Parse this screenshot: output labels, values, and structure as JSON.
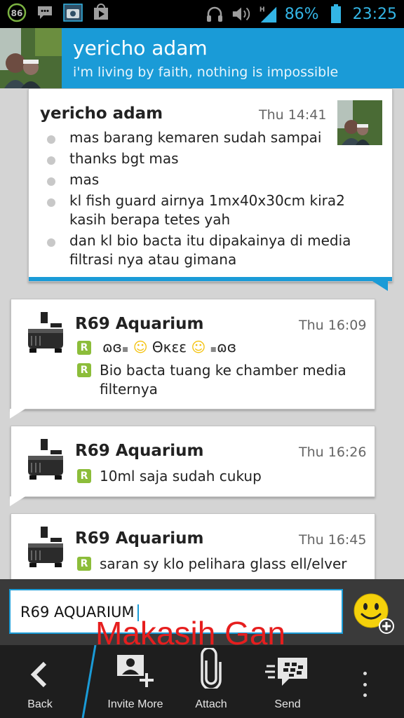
{
  "status_bar": {
    "notif_badge": "86",
    "battery_percent": "86%",
    "time": "23:25",
    "network": "H",
    "icons": [
      "bbm-notification-icon",
      "chat-icon",
      "camera-icon",
      "play-store-icon",
      "headphones-icon",
      "volume-icon",
      "signal-icon",
      "battery-icon"
    ]
  },
  "header": {
    "contact_name": "yericho adam",
    "status_message": "i'm living by faith, nothing is impossible"
  },
  "messages": [
    {
      "sender": "yericho adam",
      "time": "Thu 14:41",
      "lines": [
        "mas barang kemaren sudah sampai",
        "thanks bgt mas",
        "mas",
        "kl fish guard airnya 1mx40x30cm kira2 kasih berapa tetes yah",
        "dan kl bio bacta itu dipakainya di media filtrasi nya atau gimana"
      ]
    },
    {
      "sender": "R69 Aquarium",
      "time": "Thu 16:09",
      "lines": [
        "Θκεε",
        "Bio bacta tuang ke chamber media filternya"
      ]
    },
    {
      "sender": "R69 Aquarium",
      "time": "Thu 16:26",
      "lines": [
        "10ml saja sudah cukup"
      ]
    },
    {
      "sender": "R69 Aquarium",
      "time": "Thu 16:45",
      "lines": [
        "saran sy klo pelihara glass ell/elver"
      ]
    }
  ],
  "delivered_badge": "R",
  "composer": {
    "value": "R69 AQUARIUM"
  },
  "overlay_text": "Makasih Gan",
  "bottom_bar": {
    "back_label": "Back",
    "invite_label": "Invite More",
    "attach_label": "Attach",
    "send_label": "Send"
  },
  "colors": {
    "accent": "#1a9bd7",
    "status_blue": "#33b5e5",
    "delivered_green": "#8cbd3a",
    "overlay_red": "#e61e1e"
  }
}
